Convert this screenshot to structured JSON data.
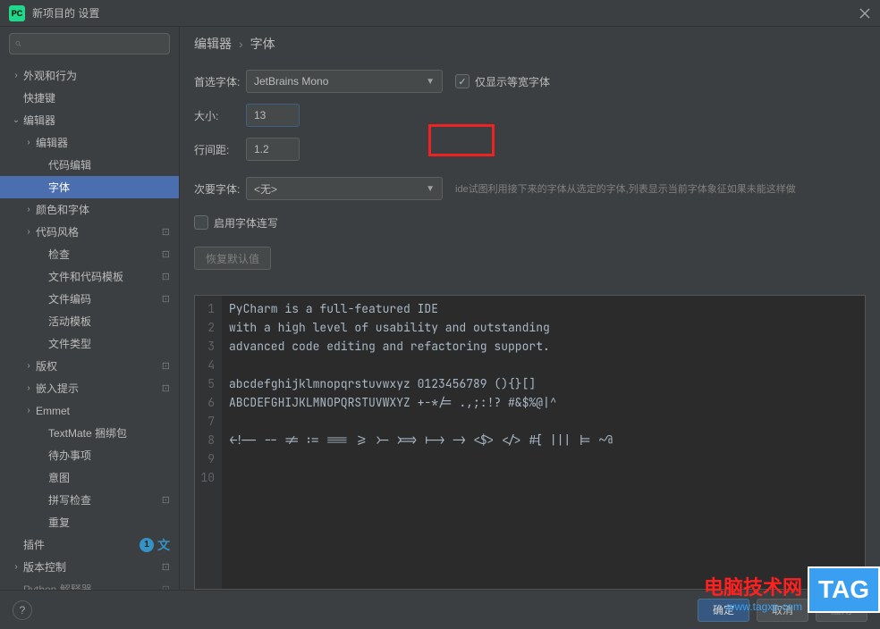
{
  "window": {
    "icon": "PC",
    "title": "新项目的 设置"
  },
  "search": {
    "placeholder": ""
  },
  "tree": {
    "appearance": "外观和行为",
    "keymap": "快捷键",
    "editor": "编辑器",
    "sub_editor": "编辑器",
    "code_edit": "代码编辑",
    "font": "字体",
    "color_font": "颜色和字体",
    "code_style": "代码风格",
    "inspect": "检查",
    "file_tmpl": "文件和代码模板",
    "file_enc": "文件编码",
    "live_tmpl": "活动模板",
    "file_types": "文件类型",
    "copyright": "版权",
    "inlay": "嵌入提示",
    "emmet": "Emmet",
    "textmate": "TextMate 捆绑包",
    "todo": "待办事项",
    "intent": "意图",
    "spell": "拼写检查",
    "dup": "重复",
    "plugins": "插件",
    "plugins_badge": "1",
    "vcs": "版本控制",
    "python": "Python 解释器"
  },
  "crumb": {
    "editor": "编辑器",
    "font": "字体"
  },
  "form": {
    "main_font_label": "首选字体:",
    "main_font_value": "JetBrains Mono",
    "mono_only": "仅显示等宽字体",
    "size_label": "大小:",
    "size_value": "13",
    "line_label": "行间距:",
    "line_value": "1.2",
    "fallback_label": "次要字体:",
    "fallback_value": "<无>",
    "fallback_hint": "ide试图利用接下来的字体从选定的字体,列表显示当前字体象征如果未能这样做",
    "ligatures": "启用字体连写",
    "restore": "恢复默认值"
  },
  "preview": {
    "lines": [
      "PyCharm is a full-featured IDE",
      "with a high level of usability and outstanding",
      "advanced code editing and refactoring support.",
      "",
      "abcdefghijklmnopqrstuvwxyz 0123456789 (){}[]",
      "ABCDEFGHIJKLMNOPQRSTUVWXYZ +-*/= .,;:!? #&$%@|^",
      "",
      "<!-- -- != := === >= >- >=> |-> -> <$> </> #[ ||| |= ~@",
      "",
      ""
    ]
  },
  "footer": {
    "ok": "确定",
    "cancel": "取消",
    "apply": "应用"
  },
  "watermark": {
    "site": "电脑技术网",
    "url": "www.tagxp.com",
    "tag": "TAG"
  },
  "cfg_icon": "⊡"
}
